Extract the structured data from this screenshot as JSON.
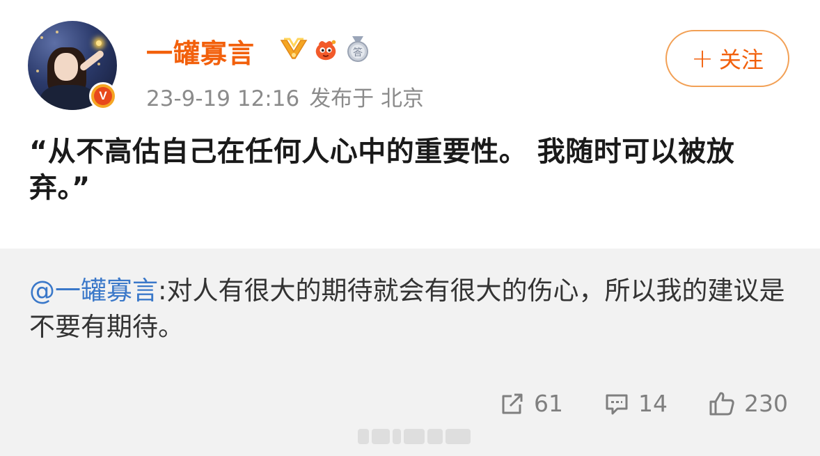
{
  "user": {
    "name": "一罐寡言",
    "verified_badge": "V",
    "badges": [
      "golden-v-icon",
      "mascot-icon",
      "medal-icon"
    ]
  },
  "post": {
    "date": "23-9-19 12:16",
    "location": "发布于 北京",
    "text": "“从不高估自己在任何人心中的重要性。 我随时可以被放弃。”"
  },
  "follow_button": {
    "plus": "+",
    "label": "关注"
  },
  "repost": {
    "mention": "@一罐寡言",
    "text": ":对人有很大的期待就会有很大的伤心，所以我的建议是不要有期待。"
  },
  "actions": {
    "share_count": "61",
    "comment_count": "14",
    "like_count": "230"
  },
  "colors": {
    "accent": "#f2600c",
    "mention": "#3a78c9",
    "muted": "#8b8b8b",
    "repost_bg": "#f2f2f2"
  }
}
